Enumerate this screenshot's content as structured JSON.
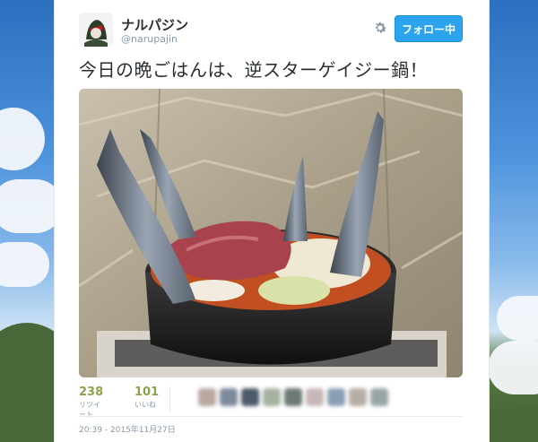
{
  "tweet": {
    "display_name": "ナルパジン",
    "handle": "@narupajin",
    "follow_label": "フォロー中",
    "text": "今日の晩ごはんは、逆スターゲイジー鍋！",
    "timestamp": "20:39 - 2015年11月27日"
  },
  "stats": {
    "retweets_count": "238",
    "retweets_label": "リツイート",
    "likes_count": "101",
    "likes_label": "いいね"
  },
  "colors": {
    "follow_button": "#2ba3ed",
    "stat_numbers": "#8aa44a",
    "muted_text": "#8899a6"
  },
  "icons": [
    "settings-gear-icon"
  ]
}
